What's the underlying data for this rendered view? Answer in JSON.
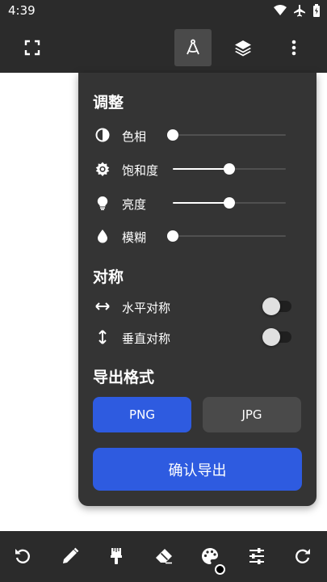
{
  "status_bar": {
    "time": "4:39",
    "icons": [
      "wifi-icon",
      "airplane-mode-icon",
      "battery-icon"
    ]
  },
  "top_bar": {
    "buttons": [
      {
        "icon": "fullscreen-icon"
      },
      {
        "icon": "compass-icon",
        "active": true
      },
      {
        "icon": "layers-icon"
      },
      {
        "icon": "more-vert-icon"
      }
    ]
  },
  "panel": {
    "adjust": {
      "title": "调整",
      "sliders": [
        {
          "label": "色相",
          "icon": "contrast-icon",
          "value": 0
        },
        {
          "label": "饱和度",
          "icon": "brightness-gear-icon",
          "value": 0.5
        },
        {
          "label": "亮度",
          "icon": "bulb-icon",
          "value": 0.5
        },
        {
          "label": "模糊",
          "icon": "drop-icon",
          "value": 0
        }
      ]
    },
    "symmetry": {
      "title": "对称",
      "toggles": [
        {
          "label": "水平对称",
          "icon": "horizontal-arrows-icon",
          "on": false
        },
        {
          "label": "垂直对称",
          "icon": "vertical-arrows-icon",
          "on": false
        }
      ]
    },
    "export_format": {
      "title": "导出格式",
      "options": [
        "PNG",
        "JPG"
      ],
      "selected": "PNG"
    },
    "confirm_label": "确认导出"
  },
  "bottom_bar": {
    "tools": [
      "undo-icon",
      "pencil-icon",
      "brush-icon",
      "eraser-icon",
      "palette-icon",
      "tune-icon",
      "redo-icon"
    ]
  },
  "colors": {
    "accent": "#2e5be0",
    "panel_bg": "#343434",
    "bar_bg": "#2b2b2b"
  }
}
